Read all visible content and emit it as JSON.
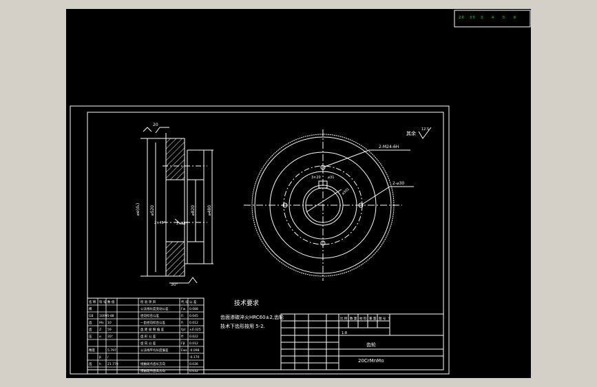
{
  "cad": {
    "colors": {
      "background": "#000000",
      "line": "#ffffff",
      "hatch": "#ffffff",
      "axis_icon": "#00ff00",
      "window": "#d4d0c8"
    },
    "axis_indicator_labels": [
      "2 6",
      "3 5",
      "3",
      "4",
      "5",
      "6"
    ],
    "left_view": {
      "diameters": [
        "⌀520",
        "⌀820",
        "⌀480"
      ],
      "chamfers": [
        "2×45°",
        "2×45°"
      ],
      "tip_label": "⌀e(d₁)",
      "bottom_label": "30°",
      "top_label": "20"
    },
    "right_view": {
      "surface_note": "其余",
      "surface_roughness": "12.5",
      "holes_label_1": "2-M24-6H",
      "holes_label_2": "2-⌀30",
      "center_labels": [
        "3×20",
        "⌀31",
        "⌀301"
      ]
    },
    "tech_requirements": {
      "title": "技术要求",
      "lines": [
        "齿面渗碳淬火HRC60±2,齿轮",
        "技术下齿形按用 5-2."
      ]
    },
    "param_table": {
      "header": [
        "名 称",
        "符 号",
        "数 值",
        "检 验 项 目",
        "代 号",
        "公 差"
      ],
      "rows": [
        [
          "模",
          "",
          "",
          "公法线长度变动公差",
          "Fw",
          "0.088"
        ],
        [
          "GB",
          "10095-88",
          "",
          "径向综合公差",
          "Fi",
          "0.045"
        ],
        [
          "齿",
          "Mn",
          "10",
          "一齿径向综合公差",
          "fi",
          "0.012"
        ],
        [
          "齿",
          "Z",
          "59",
          "齿 距 极 限 偏 差",
          "fpt",
          "±0.025"
        ],
        [
          "压",
          "α",
          "20°",
          "齿 形 公 差",
          "ff",
          "0.022"
        ],
        [
          "",
          "",
          "",
          "齿 向 公 差",
          "Fβ",
          "0.012"
        ],
        [
          "精度",
          "",
          "5.797",
          "公法线平均长度偏差",
          "Ews",
          "-0.098"
        ],
        [
          "",
          "β",
          "/",
          "",
          "",
          "-0.170"
        ],
        [
          "齿",
          "h",
          "21.779",
          "接触斑点齿长方向",
          "",
          "0.036"
        ],
        [
          "",
          "",
          "",
          "接触斑点齿高方向",
          "",
          "0.032"
        ]
      ]
    },
    "title_block": {
      "part_name": "齿轮",
      "material": "20CrMnMo",
      "scale_row": [
        "比 例",
        "数 量",
        "材 料",
        "重 量",
        "图 号",
        "S"
      ],
      "quantity": "1:8"
    }
  }
}
